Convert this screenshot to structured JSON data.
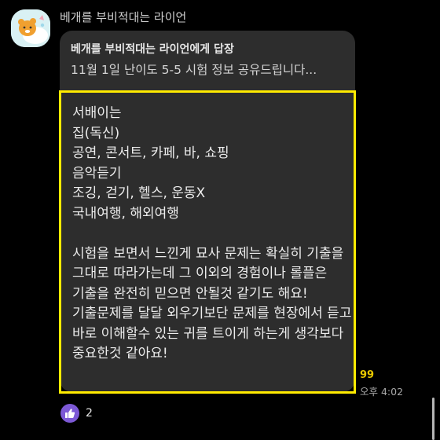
{
  "message": {
    "sender": "베개를 부비적대는 라이언",
    "reply": {
      "header": "베개를 부비적대는 라이언에게 답장",
      "preview": "11월 1일 난이도 5-5 시험 정보 공유드립니다..."
    },
    "body": "서배이는\n집(독신)\n공연, 콘서트, 카페, 바, 쇼핑\n음악듣기\n조깅, 걷기, 헬스, 운동X\n국내여행, 해외여행\n\n시험을 보면서 느낀게 묘사 문제는 확실히 기출을 그대로 따라가는데 그 이외의 경험이나 롤플은 기출을 완전히 믿으면 안될것 같기도 해요! 기출문제를 달달 외우기보단 문제를 현장에서 듣고 바로 이해할수 있는 귀를 트이게 하는게 생각보다 중요한것 같아요!",
    "unread_count": "99",
    "time": "오후 4:02",
    "reaction": {
      "icon": "thumbs-up-icon",
      "count": "2"
    }
  },
  "colors": {
    "background": "#000000",
    "bubble": "#2d2d2d",
    "highlight": "#ffeb00",
    "unread": "#e8c800",
    "reaction": "#7d59d6"
  },
  "avatar": {
    "icon": "ryan-character-icon"
  }
}
